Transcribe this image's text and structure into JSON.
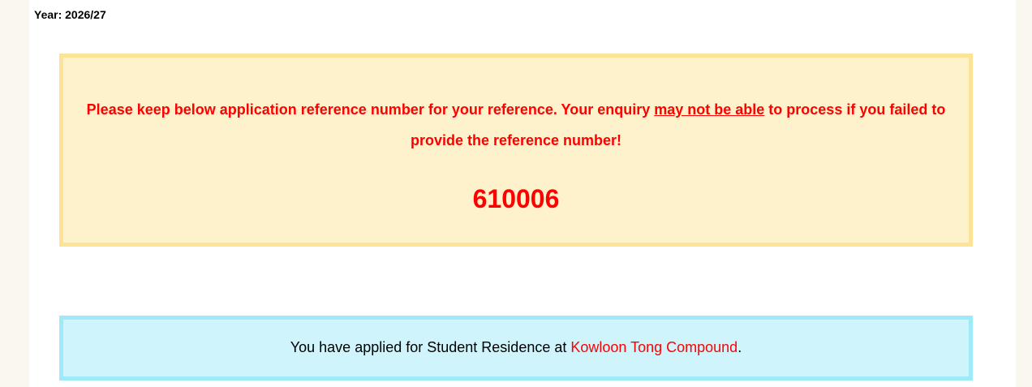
{
  "header": {
    "year_label": "Year: 2026/27"
  },
  "notice": {
    "text_part1": "Please keep below application reference number for your reference. Your enquiry ",
    "emphasis": "may not be able",
    "text_part2": " to process if you failed to provide the reference number!",
    "reference_number": "610006",
    "text_color": "#ff0000",
    "background_color": "#fef2cc",
    "border_color": "#fde396"
  },
  "application": {
    "prefix": "You have applied for Student Residence at ",
    "residence": "Kowloon Tong Compound",
    "suffix": ".",
    "background_color": "#cff4fc",
    "border_color": "#9eeaf9"
  }
}
